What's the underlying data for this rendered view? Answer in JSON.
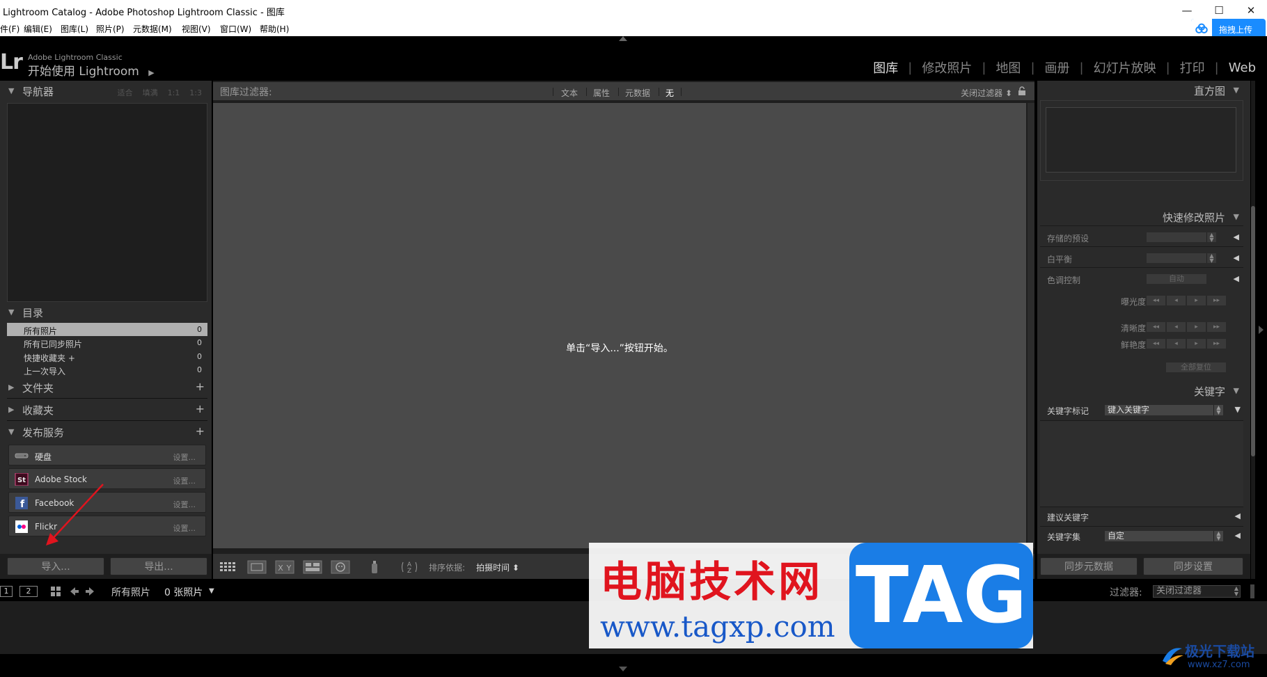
{
  "window": {
    "title": "Lightroom Catalog - Adobe Photoshop Lightroom Classic - 图库",
    "minimize": "—",
    "maximize": "☐",
    "close": "✕"
  },
  "menu": [
    "件(F)",
    "编辑(E)",
    "图库(L)",
    "照片(P)",
    "元数据(M)",
    "视图(V)",
    "窗口(W)",
    "帮助(H)"
  ],
  "cloud_upload": {
    "label": "拖拽上传",
    "icon": "cloud-icon",
    "color": "#1a8cff"
  },
  "identity": {
    "logo": "Lr",
    "product": "Adobe Lightroom Classic",
    "greeting": "开始使用 Lightroom",
    "arrow": "▶"
  },
  "modules": [
    "图库",
    "修改照片",
    "地图",
    "画册",
    "幻灯片放映",
    "打印",
    "Web"
  ],
  "left_panel": {
    "navigator": {
      "title": "导航器",
      "options": [
        "适合",
        "填满",
        "1:1",
        "1:3"
      ]
    },
    "catalog": {
      "title": "目录",
      "items": [
        {
          "name": "所有照片",
          "count": "0"
        },
        {
          "name": "所有已同步照片",
          "count": "0"
        },
        {
          "name": "快捷收藏夹 +",
          "count": "0"
        },
        {
          "name": "上一次导入",
          "count": "0"
        }
      ]
    },
    "folders": {
      "title": "文件夹"
    },
    "collections": {
      "title": "收藏夹"
    },
    "publish": {
      "title": "发布服务",
      "services": [
        {
          "name": "硬盘",
          "setup": "设置..."
        },
        {
          "name": "Adobe Stock",
          "setup": "设置..."
        },
        {
          "name": "Facebook",
          "setup": "设置..."
        },
        {
          "name": "Flickr",
          "setup": "设置..."
        }
      ]
    },
    "import_button": "导入...",
    "export_button": "导出..."
  },
  "filter_bar": {
    "label": "图库过滤器:",
    "tabs": [
      "文本",
      "属性",
      "元数据",
      "无"
    ],
    "active": "无",
    "right": "关闭过滤器 ⬍"
  },
  "grid": {
    "message": "单击“导入...”按钮开始。"
  },
  "toolbar": {
    "sort_label": "排序依据:",
    "sort_value": "拍摄时间 ⬍"
  },
  "right_panel": {
    "histogram": {
      "title": "直方图"
    },
    "quick_develop": {
      "title": "快速修改照片",
      "saved_preset": "存储的预设",
      "white_balance": "白平衡",
      "tone_control": "色调控制",
      "auto": "自动",
      "exposure": "曝光度",
      "clarity": "清晰度",
      "vibrance": "鲜艳度",
      "reset_all": "全部复位",
      "steps": [
        "◂◂",
        "◂",
        "▸",
        "▸▸"
      ]
    },
    "keywording": {
      "title": "关键字",
      "tags_label": "关键字标记",
      "tags_value": "键入关键字",
      "suggestions": "建议关键字",
      "set_label": "关键字集",
      "set_value": "自定"
    },
    "sync_metadata": "同步元数据",
    "sync_settings": "同步设置"
  },
  "filmstrip": {
    "view1": "1",
    "view2": "2",
    "source": "所有照片",
    "count": "0 张照片",
    "filter_label": "过滤器:",
    "filter_value": "关闭过滤器"
  },
  "watermark": {
    "site_name": "电脑技术网",
    "url": "www.tagxp.com",
    "tag": "TAG",
    "corner_name": "极光下载站",
    "corner_url": "www.xz7.com"
  }
}
